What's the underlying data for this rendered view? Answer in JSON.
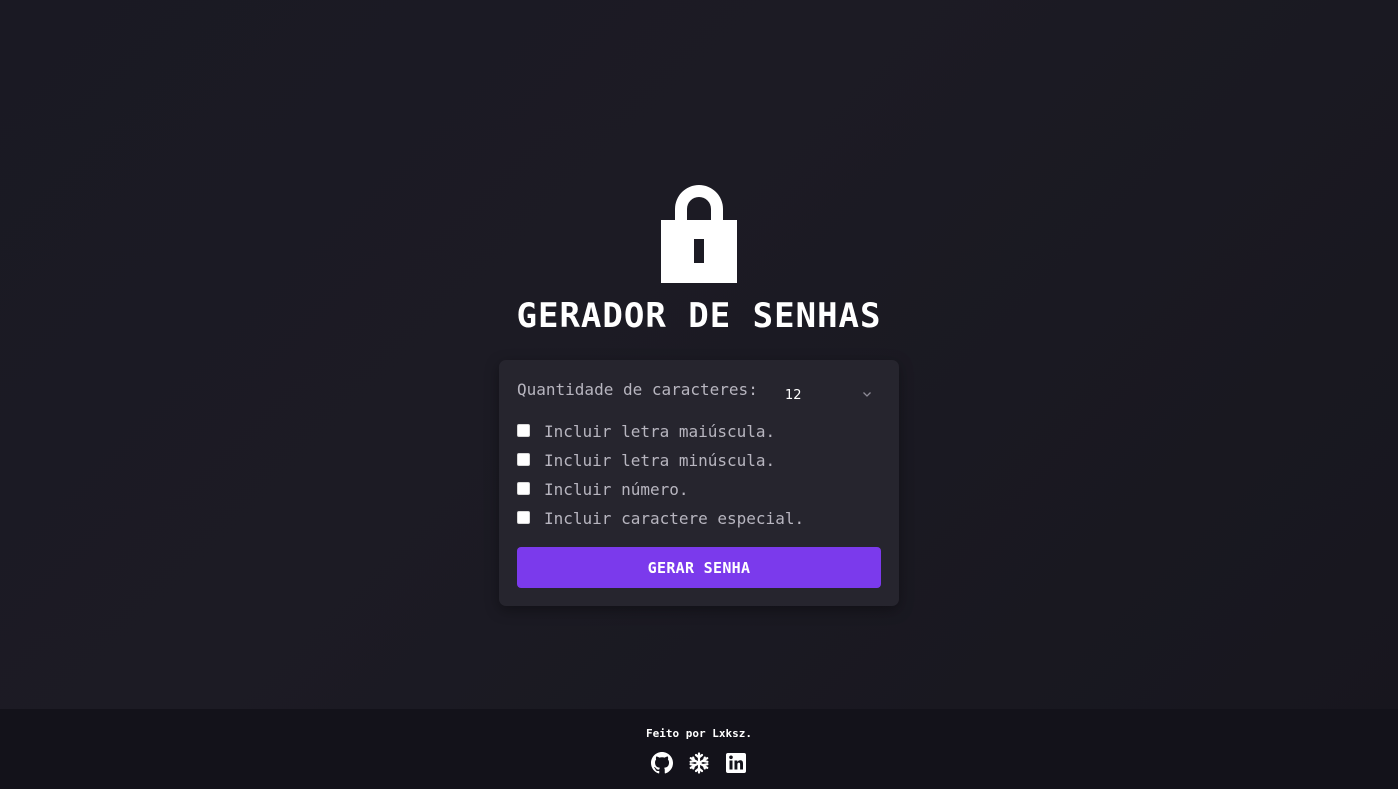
{
  "header": {
    "icon": "lock-icon",
    "title": "GERADOR DE SENHAS"
  },
  "form": {
    "length_label": "Quantidade de caracteres:",
    "length_value": "12",
    "options": [
      {
        "label": "Incluir letra maiúscula.",
        "checked": false
      },
      {
        "label": "Incluir letra minúscula.",
        "checked": false
      },
      {
        "label": "Incluir número.",
        "checked": false
      },
      {
        "label": "Incluir caractere especial.",
        "checked": false
      }
    ],
    "submit_label": "GERAR SENHA"
  },
  "footer": {
    "credit": "Feito por Lxksz.",
    "links": [
      "github-icon",
      "snowflake-icon",
      "linkedin-icon"
    ]
  },
  "colors": {
    "background": "#1c1b24",
    "card": "#26252e",
    "accent": "#7b3aec",
    "footer": "#13121a",
    "muted_text": "#b7b5bf"
  }
}
